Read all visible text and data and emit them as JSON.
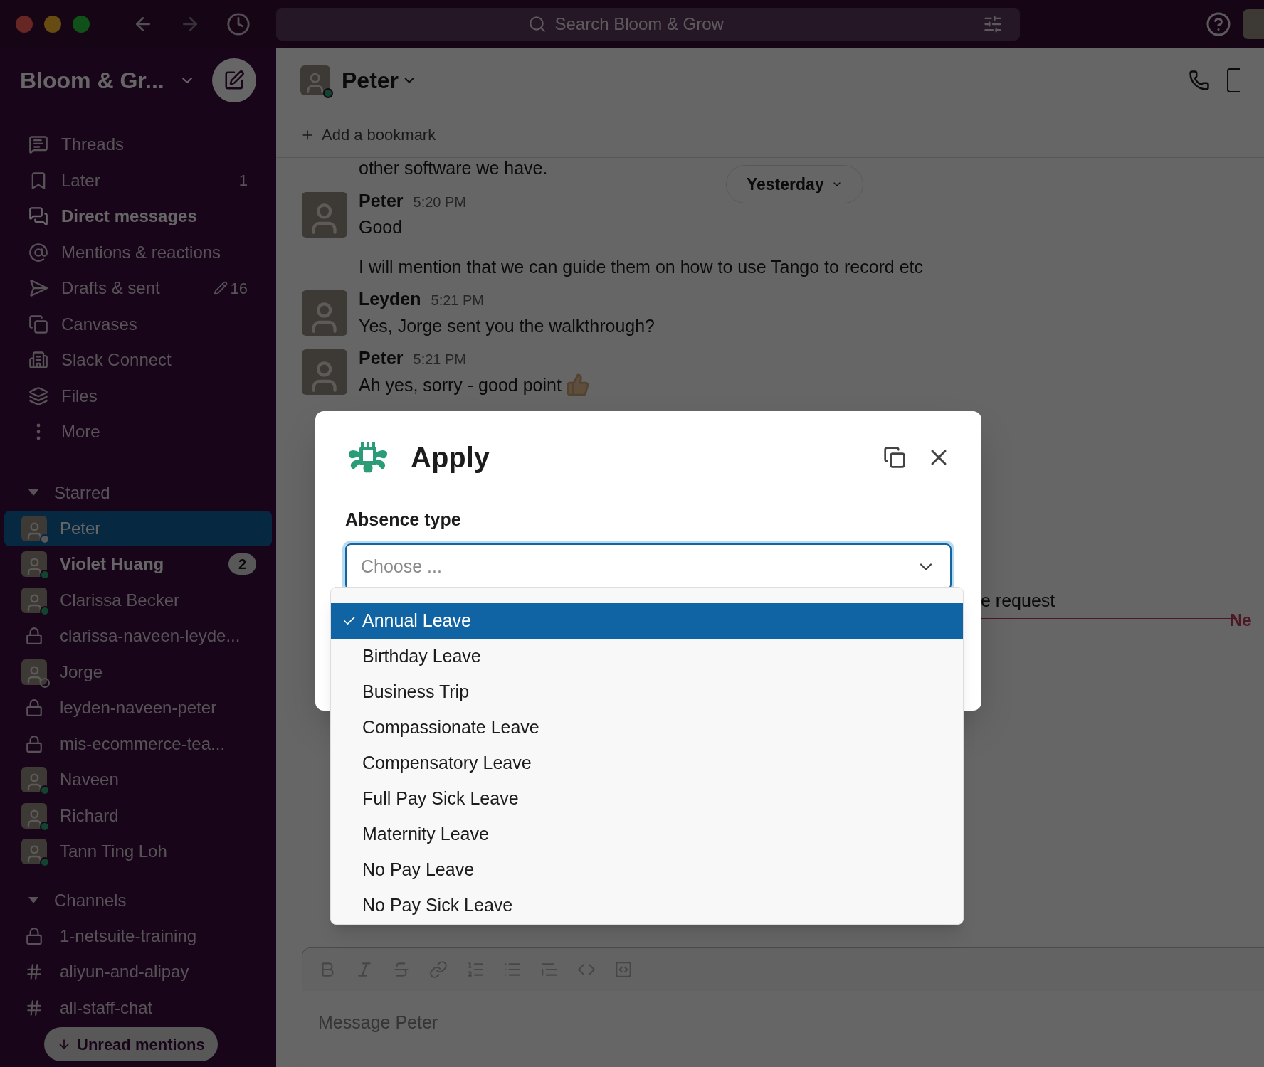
{
  "topbar": {
    "search": {
      "placeholder": "Search Bloom & Grow"
    }
  },
  "sidebar": {
    "workspace": "Bloom & Gr...",
    "nav": [
      {
        "kind": "threads",
        "label": "Threads",
        "active": false
      },
      {
        "kind": "later",
        "label": "Later",
        "count": "1",
        "active": false
      },
      {
        "kind": "dms",
        "label": "Direct messages",
        "active": true
      },
      {
        "kind": "mentions",
        "label": "Mentions & reactions",
        "active": false
      },
      {
        "kind": "drafts",
        "label": "Drafts & sent",
        "count": "16",
        "active": false
      },
      {
        "kind": "canvases",
        "label": "Canvases",
        "active": false
      },
      {
        "kind": "connect",
        "label": "Slack Connect",
        "active": false
      },
      {
        "kind": "files",
        "label": "Files",
        "active": false
      },
      {
        "kind": "more",
        "label": "More",
        "active": false
      }
    ],
    "sections": [
      {
        "title": "Starred",
        "expanded": true,
        "items": [
          {
            "kind": "dm",
            "name": "Peter",
            "online": true,
            "selected": true,
            "unread": false
          },
          {
            "kind": "dm",
            "name": "Violet Huang",
            "online": true,
            "selected": false,
            "unread": true,
            "badge": "2"
          },
          {
            "kind": "dm",
            "name": "Clarissa Becker",
            "online": true,
            "selected": false,
            "unread": false
          },
          {
            "kind": "private",
            "name": "clarissa-naveen-leyde...",
            "selected": false,
            "unread": false
          },
          {
            "kind": "dm",
            "name": "Jorge",
            "online": false,
            "selected": false,
            "unread": false
          },
          {
            "kind": "private",
            "name": "leyden-naveen-peter",
            "selected": false,
            "unread": false
          },
          {
            "kind": "private",
            "name": "mis-ecommerce-tea...",
            "selected": false,
            "unread": false
          },
          {
            "kind": "dm",
            "name": "Naveen",
            "online": true,
            "selected": false,
            "unread": false
          },
          {
            "kind": "dm",
            "name": "Richard",
            "online": true,
            "selected": false,
            "unread": false
          },
          {
            "kind": "dm",
            "name": "Tann Ting Loh",
            "online": true,
            "selected": false,
            "unread": false
          }
        ]
      },
      {
        "title": "Channels",
        "expanded": true,
        "items": [
          {
            "kind": "private",
            "name": "1-netsuite-training",
            "selected": false,
            "unread": false
          },
          {
            "kind": "public",
            "name": "aliyun-and-alipay",
            "selected": false,
            "unread": false
          },
          {
            "kind": "public",
            "name": "all-staff-chat",
            "selected": false,
            "unread": false
          }
        ]
      }
    ],
    "unread_button": "Unread mentions"
  },
  "chat": {
    "name": "Peter",
    "online": true,
    "bookmark": "Add a bookmark",
    "date_pill": "Yesterday",
    "messages": [
      {
        "kind": "continuation",
        "lines": [
          "other software we have."
        ]
      },
      {
        "kind": "message",
        "author": "Peter",
        "time": "5:20 PM",
        "lines": [
          "Good",
          "I will mention that we can guide them on how to use Tango to record etc"
        ]
      },
      {
        "kind": "message",
        "author": "Leyden",
        "time": "5:21 PM",
        "lines": [
          "Yes, Jorge sent you the walkthrough?"
        ]
      },
      {
        "kind": "message",
        "author": "Peter",
        "time": "5:21 PM",
        "lines": [
          "Ah yes, sorry - good point"
        ]
      }
    ],
    "partial_text": "e request",
    "new_divider": "Ne",
    "composer": {
      "placeholder": "Message Peter"
    }
  },
  "modal": {
    "title": "Apply",
    "field_label": "Absence type",
    "select": {
      "placeholder": "Choose ...",
      "expanded": true
    },
    "options": [
      {
        "label": "Annual Leave",
        "selected": true
      },
      {
        "label": "Birthday Leave",
        "selected": false
      },
      {
        "label": "Business Trip",
        "selected": false
      },
      {
        "label": "Compassionate Leave",
        "selected": false
      },
      {
        "label": "Compensatory Leave",
        "selected": false
      },
      {
        "label": "Full Pay Sick Leave",
        "selected": false
      },
      {
        "label": "Maternity Leave",
        "selected": false
      },
      {
        "label": "No Pay Leave",
        "selected": false
      },
      {
        "label": "No Pay Sick Leave",
        "selected": false
      }
    ]
  }
}
